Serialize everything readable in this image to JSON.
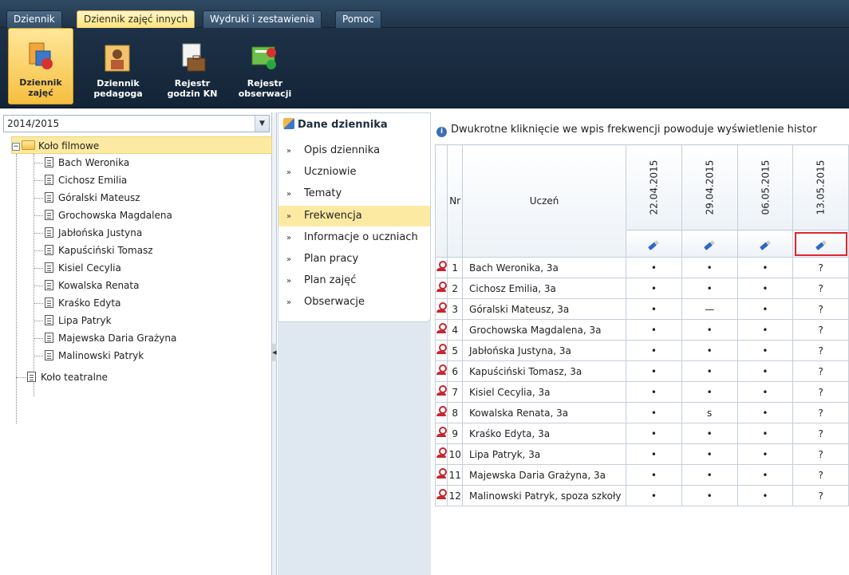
{
  "menu": {
    "tabs": [
      {
        "label": "Dziennik"
      },
      {
        "label": "Dziennik zajęć innych"
      },
      {
        "label": "Wydruki i zestawienia"
      },
      {
        "label": "Pomoc"
      }
    ]
  },
  "ribbon": {
    "buttons": [
      {
        "label": "Dziennik zajęć",
        "icon": "journal-icon"
      },
      {
        "label": "Dziennik pedagoga",
        "icon": "pedagogue-icon"
      },
      {
        "label": "Rejestr godzin KN",
        "icon": "briefcase-icon"
      },
      {
        "label": "Rejestr obserwacji",
        "icon": "observation-icon"
      }
    ]
  },
  "left": {
    "year": "2014/2015",
    "tree": {
      "root": "Koło filmowe",
      "students": [
        "Bach Weronika",
        "Cichosz Emilia",
        "Góralski Mateusz",
        "Grochowska Magdalena",
        "Jabłońska Justyna",
        "Kapuściński Tomasz",
        "Kisiel Cecylia",
        "Kowalska Renata",
        "Kraśko Edyta",
        "Lipa Patryk",
        "Majewska Daria Grażyna",
        "Malinowski Patryk"
      ],
      "second_root": "Koło teatralne"
    }
  },
  "nav": {
    "title": "Dane dziennika",
    "items": [
      "Opis dziennika",
      "Uczniowie",
      "Tematy",
      "Frekwencja",
      "Informacje o uczniach",
      "Plan pracy",
      "Plan zajęć",
      "Obserwacje"
    ],
    "chevron": "»"
  },
  "main": {
    "info": "Dwukrotne kliknięcie we wpis frekwencji powoduje wyświetlenie histor",
    "headers": {
      "nr": "Nr",
      "student": "Uczeń"
    },
    "dates": [
      "22.04.2015",
      "29.04.2015",
      "06.05.2015",
      "13.05.2015"
    ],
    "rows": [
      {
        "nr": "1",
        "name": "Bach Weronika, 3a",
        "marks": [
          "•",
          "•",
          "•",
          "?"
        ]
      },
      {
        "nr": "2",
        "name": "Cichosz Emilia, 3a",
        "marks": [
          "•",
          "•",
          "•",
          "?"
        ]
      },
      {
        "nr": "3",
        "name": "Góralski Mateusz, 3a",
        "marks": [
          "•",
          "—",
          "•",
          "?"
        ]
      },
      {
        "nr": "4",
        "name": "Grochowska Magdalena, 3a",
        "marks": [
          "•",
          "•",
          "•",
          "?"
        ]
      },
      {
        "nr": "5",
        "name": "Jabłońska Justyna, 3a",
        "marks": [
          "•",
          "•",
          "•",
          "?"
        ]
      },
      {
        "nr": "6",
        "name": "Kapuściński Tomasz, 3a",
        "marks": [
          "•",
          "•",
          "•",
          "?"
        ]
      },
      {
        "nr": "7",
        "name": "Kisiel Cecylia, 3a",
        "marks": [
          "•",
          "•",
          "•",
          "?"
        ]
      },
      {
        "nr": "8",
        "name": "Kowalska Renata, 3a",
        "marks": [
          "•",
          "s",
          "•",
          "?"
        ]
      },
      {
        "nr": "9",
        "name": "Kraśko Edyta, 3a",
        "marks": [
          "•",
          "•",
          "•",
          "?"
        ]
      },
      {
        "nr": "10",
        "name": "Lipa Patryk, 3a",
        "marks": [
          "•",
          "•",
          "•",
          "?"
        ]
      },
      {
        "nr": "11",
        "name": "Majewska Daria Grażyna, 3a",
        "marks": [
          "•",
          "•",
          "•",
          "?"
        ]
      },
      {
        "nr": "12",
        "name": "Malinowski Patryk, spoza szkoły",
        "marks": [
          "•",
          "•",
          "•",
          "?"
        ]
      }
    ]
  },
  "colors": {
    "accent": "#fdeaa2",
    "header_dark": "#1e3147",
    "highlight_border": "#e0242e"
  }
}
